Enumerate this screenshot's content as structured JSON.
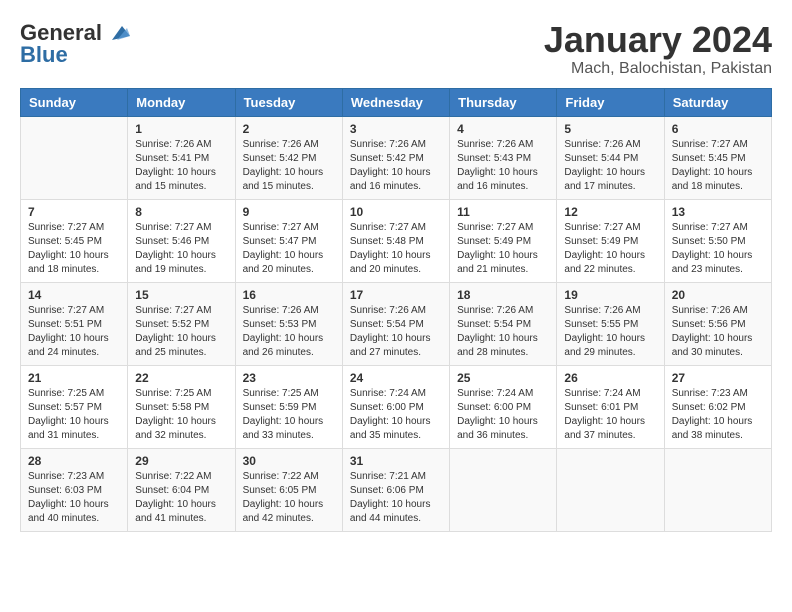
{
  "logo": {
    "general": "General",
    "blue": "Blue"
  },
  "title": "January 2024",
  "subtitle": "Mach, Balochistan, Pakistan",
  "headers": [
    "Sunday",
    "Monday",
    "Tuesday",
    "Wednesday",
    "Thursday",
    "Friday",
    "Saturday"
  ],
  "weeks": [
    [
      {
        "day": "",
        "sunrise": "",
        "sunset": "",
        "daylight": ""
      },
      {
        "day": "1",
        "sunrise": "Sunrise: 7:26 AM",
        "sunset": "Sunset: 5:41 PM",
        "daylight": "Daylight: 10 hours and 15 minutes."
      },
      {
        "day": "2",
        "sunrise": "Sunrise: 7:26 AM",
        "sunset": "Sunset: 5:42 PM",
        "daylight": "Daylight: 10 hours and 15 minutes."
      },
      {
        "day": "3",
        "sunrise": "Sunrise: 7:26 AM",
        "sunset": "Sunset: 5:42 PM",
        "daylight": "Daylight: 10 hours and 16 minutes."
      },
      {
        "day": "4",
        "sunrise": "Sunrise: 7:26 AM",
        "sunset": "Sunset: 5:43 PM",
        "daylight": "Daylight: 10 hours and 16 minutes."
      },
      {
        "day": "5",
        "sunrise": "Sunrise: 7:26 AM",
        "sunset": "Sunset: 5:44 PM",
        "daylight": "Daylight: 10 hours and 17 minutes."
      },
      {
        "day": "6",
        "sunrise": "Sunrise: 7:27 AM",
        "sunset": "Sunset: 5:45 PM",
        "daylight": "Daylight: 10 hours and 18 minutes."
      }
    ],
    [
      {
        "day": "7",
        "sunrise": "Sunrise: 7:27 AM",
        "sunset": "Sunset: 5:45 PM",
        "daylight": "Daylight: 10 hours and 18 minutes."
      },
      {
        "day": "8",
        "sunrise": "Sunrise: 7:27 AM",
        "sunset": "Sunset: 5:46 PM",
        "daylight": "Daylight: 10 hours and 19 minutes."
      },
      {
        "day": "9",
        "sunrise": "Sunrise: 7:27 AM",
        "sunset": "Sunset: 5:47 PM",
        "daylight": "Daylight: 10 hours and 20 minutes."
      },
      {
        "day": "10",
        "sunrise": "Sunrise: 7:27 AM",
        "sunset": "Sunset: 5:48 PM",
        "daylight": "Daylight: 10 hours and 20 minutes."
      },
      {
        "day": "11",
        "sunrise": "Sunrise: 7:27 AM",
        "sunset": "Sunset: 5:49 PM",
        "daylight": "Daylight: 10 hours and 21 minutes."
      },
      {
        "day": "12",
        "sunrise": "Sunrise: 7:27 AM",
        "sunset": "Sunset: 5:49 PM",
        "daylight": "Daylight: 10 hours and 22 minutes."
      },
      {
        "day": "13",
        "sunrise": "Sunrise: 7:27 AM",
        "sunset": "Sunset: 5:50 PM",
        "daylight": "Daylight: 10 hours and 23 minutes."
      }
    ],
    [
      {
        "day": "14",
        "sunrise": "Sunrise: 7:27 AM",
        "sunset": "Sunset: 5:51 PM",
        "daylight": "Daylight: 10 hours and 24 minutes."
      },
      {
        "day": "15",
        "sunrise": "Sunrise: 7:27 AM",
        "sunset": "Sunset: 5:52 PM",
        "daylight": "Daylight: 10 hours and 25 minutes."
      },
      {
        "day": "16",
        "sunrise": "Sunrise: 7:26 AM",
        "sunset": "Sunset: 5:53 PM",
        "daylight": "Daylight: 10 hours and 26 minutes."
      },
      {
        "day": "17",
        "sunrise": "Sunrise: 7:26 AM",
        "sunset": "Sunset: 5:54 PM",
        "daylight": "Daylight: 10 hours and 27 minutes."
      },
      {
        "day": "18",
        "sunrise": "Sunrise: 7:26 AM",
        "sunset": "Sunset: 5:54 PM",
        "daylight": "Daylight: 10 hours and 28 minutes."
      },
      {
        "day": "19",
        "sunrise": "Sunrise: 7:26 AM",
        "sunset": "Sunset: 5:55 PM",
        "daylight": "Daylight: 10 hours and 29 minutes."
      },
      {
        "day": "20",
        "sunrise": "Sunrise: 7:26 AM",
        "sunset": "Sunset: 5:56 PM",
        "daylight": "Daylight: 10 hours and 30 minutes."
      }
    ],
    [
      {
        "day": "21",
        "sunrise": "Sunrise: 7:25 AM",
        "sunset": "Sunset: 5:57 PM",
        "daylight": "Daylight: 10 hours and 31 minutes."
      },
      {
        "day": "22",
        "sunrise": "Sunrise: 7:25 AM",
        "sunset": "Sunset: 5:58 PM",
        "daylight": "Daylight: 10 hours and 32 minutes."
      },
      {
        "day": "23",
        "sunrise": "Sunrise: 7:25 AM",
        "sunset": "Sunset: 5:59 PM",
        "daylight": "Daylight: 10 hours and 33 minutes."
      },
      {
        "day": "24",
        "sunrise": "Sunrise: 7:24 AM",
        "sunset": "Sunset: 6:00 PM",
        "daylight": "Daylight: 10 hours and 35 minutes."
      },
      {
        "day": "25",
        "sunrise": "Sunrise: 7:24 AM",
        "sunset": "Sunset: 6:00 PM",
        "daylight": "Daylight: 10 hours and 36 minutes."
      },
      {
        "day": "26",
        "sunrise": "Sunrise: 7:24 AM",
        "sunset": "Sunset: 6:01 PM",
        "daylight": "Daylight: 10 hours and 37 minutes."
      },
      {
        "day": "27",
        "sunrise": "Sunrise: 7:23 AM",
        "sunset": "Sunset: 6:02 PM",
        "daylight": "Daylight: 10 hours and 38 minutes."
      }
    ],
    [
      {
        "day": "28",
        "sunrise": "Sunrise: 7:23 AM",
        "sunset": "Sunset: 6:03 PM",
        "daylight": "Daylight: 10 hours and 40 minutes."
      },
      {
        "day": "29",
        "sunrise": "Sunrise: 7:22 AM",
        "sunset": "Sunset: 6:04 PM",
        "daylight": "Daylight: 10 hours and 41 minutes."
      },
      {
        "day": "30",
        "sunrise": "Sunrise: 7:22 AM",
        "sunset": "Sunset: 6:05 PM",
        "daylight": "Daylight: 10 hours and 42 minutes."
      },
      {
        "day": "31",
        "sunrise": "Sunrise: 7:21 AM",
        "sunset": "Sunset: 6:06 PM",
        "daylight": "Daylight: 10 hours and 44 minutes."
      },
      {
        "day": "",
        "sunrise": "",
        "sunset": "",
        "daylight": ""
      },
      {
        "day": "",
        "sunrise": "",
        "sunset": "",
        "daylight": ""
      },
      {
        "day": "",
        "sunrise": "",
        "sunset": "",
        "daylight": ""
      }
    ]
  ]
}
